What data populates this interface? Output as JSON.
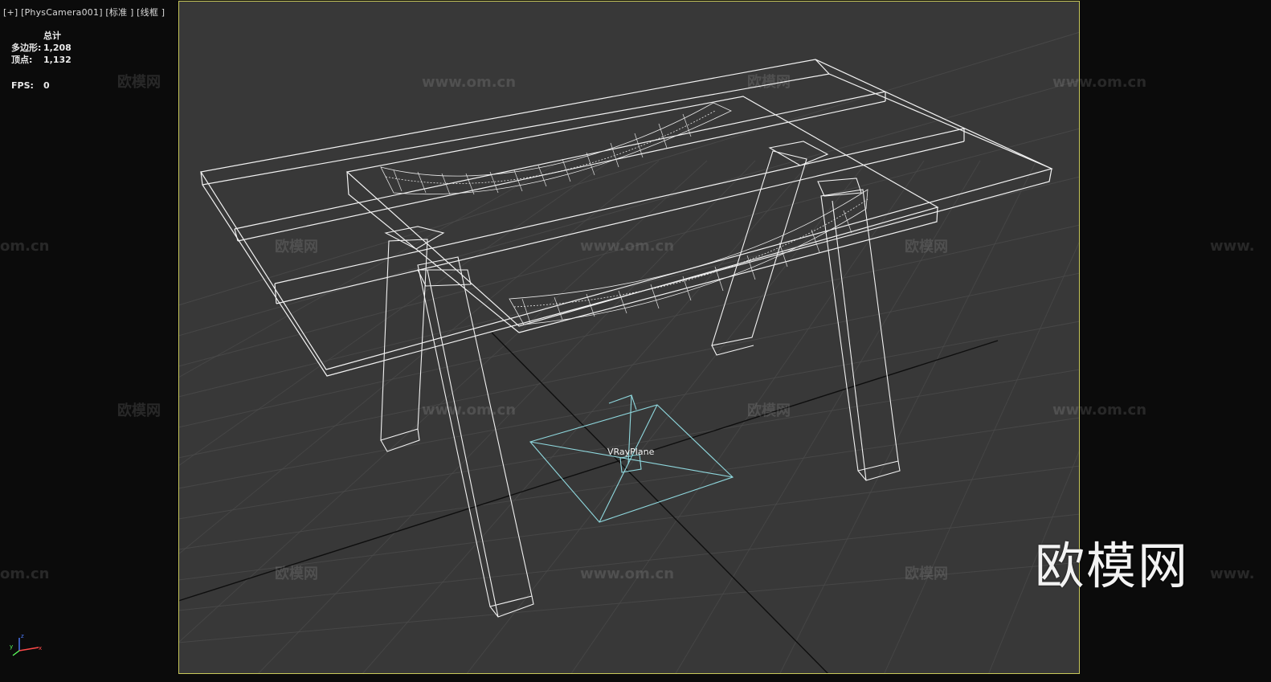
{
  "viewport": {
    "label": "[+]  [PhysCamera001]  [标准 ]  [线框 ]"
  },
  "stats": {
    "header": "总计",
    "polygons_label": "多边形:",
    "polygons_value": "1,208",
    "vertices_label": "顶点:",
    "vertices_value": "1,132",
    "fps_label": "FPS:",
    "fps_value": "0"
  },
  "scene": {
    "object_label": "VRayPlane"
  },
  "watermarks": {
    "cn": "欧模网",
    "url": "www.om.cn",
    "url_short": "om.cn",
    "url_cut": "www."
  },
  "logo": "欧模网",
  "axis": {
    "z": "z",
    "y": "y",
    "x": "x"
  },
  "colors": {
    "background": "#0b0b0b",
    "viewport_bg": "#383838",
    "viewport_border": "#c8c85a",
    "wire": "#f0f0f0",
    "light": "#8fd8de"
  }
}
